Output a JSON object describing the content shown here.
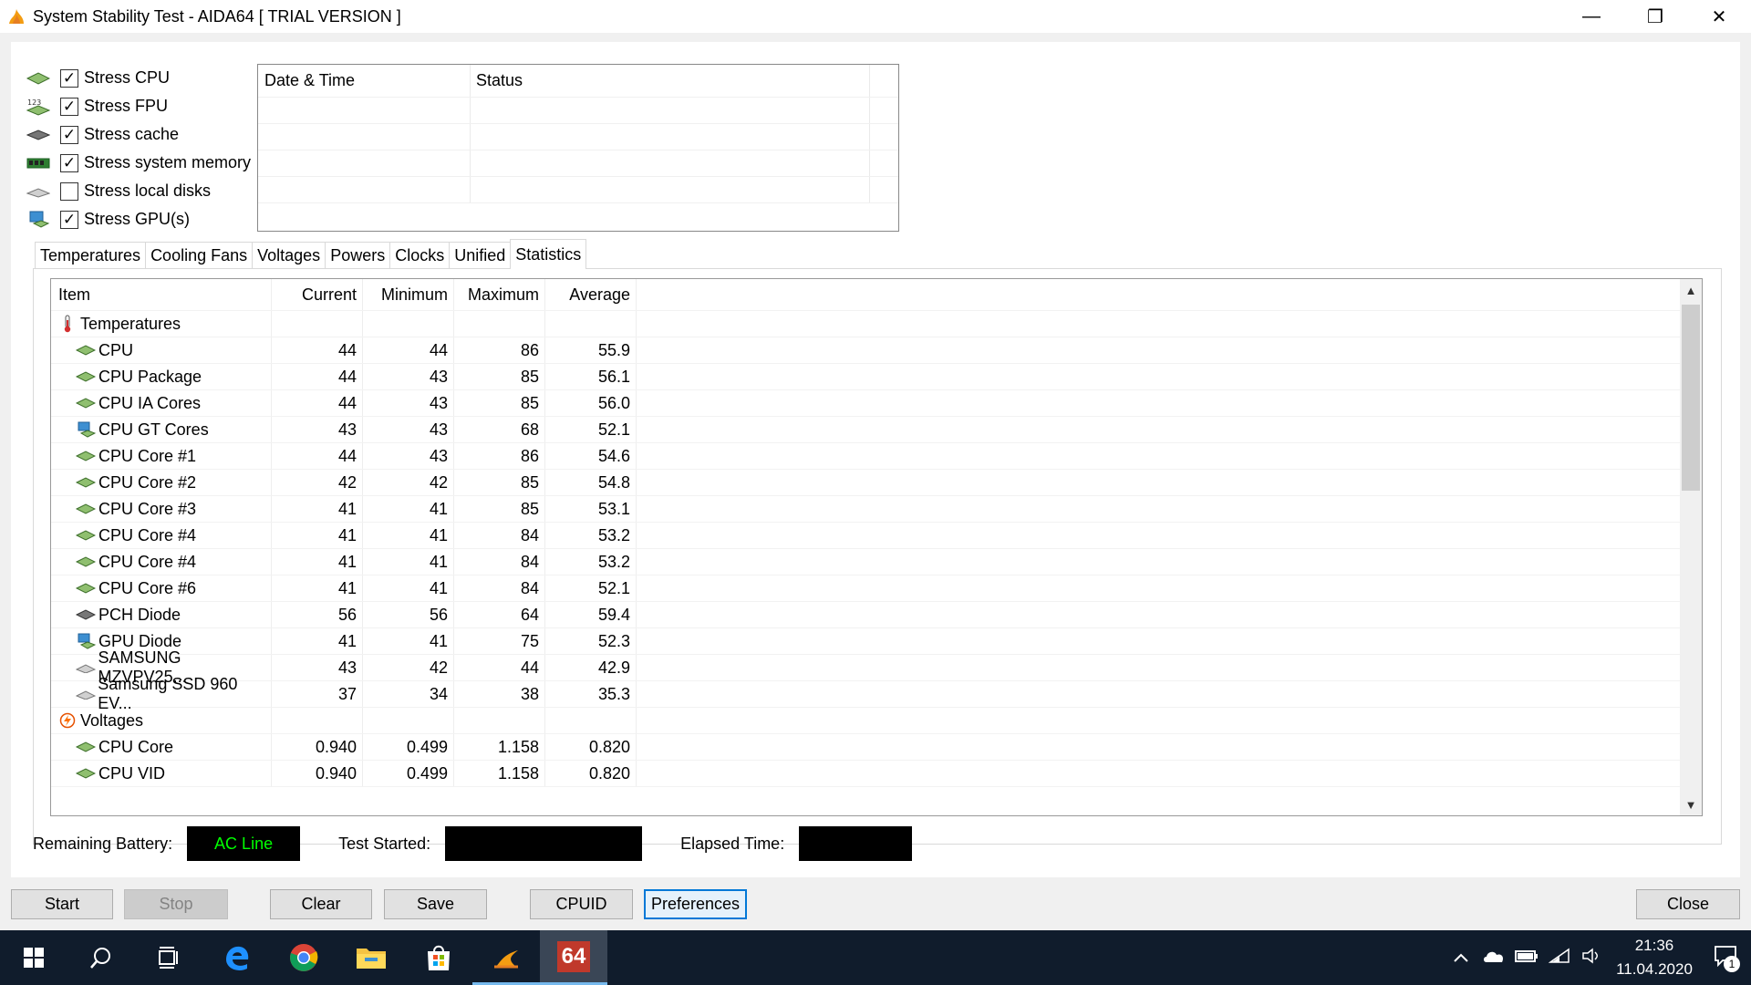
{
  "window": {
    "title": "System Stability Test - AIDA64  [ TRIAL VERSION ]",
    "minimize": "—",
    "maximize": "❐",
    "close": "✕"
  },
  "stress_options": [
    {
      "label": "Stress CPU",
      "checked": true,
      "icon": "cpu-chip-icon",
      "mark": "✓"
    },
    {
      "label": "Stress FPU",
      "checked": true,
      "icon": "fpu-chip-icon",
      "mark": "✓"
    },
    {
      "label": "Stress cache",
      "checked": true,
      "icon": "cache-chip-icon",
      "mark": "✓"
    },
    {
      "label": "Stress system memory",
      "checked": true,
      "icon": "memory-module-icon",
      "mark": "✓"
    },
    {
      "label": "Stress local disks",
      "checked": false,
      "icon": "disk-drive-icon",
      "mark": ""
    },
    {
      "label": "Stress GPU(s)",
      "checked": true,
      "icon": "gpu-monitor-icon",
      "mark": "✓"
    }
  ],
  "log": {
    "headers": {
      "datetime": "Date & Time",
      "status": "Status"
    }
  },
  "tabs": [
    "Temperatures",
    "Cooling Fans",
    "Voltages",
    "Powers",
    "Clocks",
    "Unified",
    "Statistics"
  ],
  "active_tab": "Statistics",
  "stats": {
    "headers": {
      "item": "Item",
      "current": "Current",
      "minimum": "Minimum",
      "maximum": "Maximum",
      "average": "Average"
    },
    "rows": [
      {
        "type": "group",
        "icon": "thermometer-icon",
        "item": "Temperatures"
      },
      {
        "type": "child",
        "icon": "cpu-chip-icon",
        "item": "CPU",
        "current": "44",
        "minimum": "44",
        "maximum": "86",
        "average": "55.9"
      },
      {
        "type": "child",
        "icon": "cpu-chip-icon",
        "item": "CPU Package",
        "current": "44",
        "minimum": "43",
        "maximum": "85",
        "average": "56.1"
      },
      {
        "type": "child",
        "icon": "cpu-chip-icon",
        "item": "CPU IA Cores",
        "current": "44",
        "minimum": "43",
        "maximum": "85",
        "average": "56.0"
      },
      {
        "type": "child",
        "icon": "gpu-monitor-icon",
        "item": "CPU GT Cores",
        "current": "43",
        "minimum": "43",
        "maximum": "68",
        "average": "52.1"
      },
      {
        "type": "child",
        "icon": "cpu-chip-icon",
        "item": "CPU Core #1",
        "current": "44",
        "minimum": "43",
        "maximum": "86",
        "average": "54.6"
      },
      {
        "type": "child",
        "icon": "cpu-chip-icon",
        "item": "CPU Core #2",
        "current": "42",
        "minimum": "42",
        "maximum": "85",
        "average": "54.8"
      },
      {
        "type": "child",
        "icon": "cpu-chip-icon",
        "item": "CPU Core #3",
        "current": "41",
        "minimum": "41",
        "maximum": "85",
        "average": "53.1"
      },
      {
        "type": "child",
        "icon": "cpu-chip-icon",
        "item": "CPU Core #4",
        "current": "41",
        "minimum": "41",
        "maximum": "84",
        "average": "53.2"
      },
      {
        "type": "child",
        "icon": "cpu-chip-icon",
        "item": "CPU Core #4",
        "current": "41",
        "minimum": "41",
        "maximum": "84",
        "average": "53.2"
      },
      {
        "type": "child",
        "icon": "cpu-chip-icon",
        "item": "CPU Core #6",
        "current": "41",
        "minimum": "41",
        "maximum": "84",
        "average": "52.1"
      },
      {
        "type": "child",
        "icon": "pch-chip-icon",
        "item": "PCH Diode",
        "current": "56",
        "minimum": "56",
        "maximum": "64",
        "average": "59.4"
      },
      {
        "type": "child",
        "icon": "gpu-monitor-icon",
        "item": "GPU Diode",
        "current": "41",
        "minimum": "41",
        "maximum": "75",
        "average": "52.3"
      },
      {
        "type": "child",
        "icon": "disk-drive-icon",
        "item": "SAMSUNG MZVPV25...",
        "current": "43",
        "minimum": "42",
        "maximum": "44",
        "average": "42.9"
      },
      {
        "type": "child",
        "icon": "disk-drive-icon",
        "item": "Samsung SSD 960 EV...",
        "current": "37",
        "minimum": "34",
        "maximum": "38",
        "average": "35.3"
      },
      {
        "type": "group",
        "icon": "voltage-icon",
        "item": "Voltages"
      },
      {
        "type": "child",
        "icon": "cpu-chip-icon",
        "item": "CPU Core",
        "current": "0.940",
        "minimum": "0.499",
        "maximum": "1.158",
        "average": "0.820"
      },
      {
        "type": "child",
        "icon": "cpu-chip-icon",
        "item": "CPU VID",
        "current": "0.940",
        "minimum": "0.499",
        "maximum": "1.158",
        "average": "0.820"
      }
    ]
  },
  "status": {
    "battery_label": "Remaining Battery:",
    "battery_value": "AC Line",
    "test_started_label": "Test Started:",
    "test_started_value": "",
    "elapsed_label": "Elapsed Time:",
    "elapsed_value": ""
  },
  "buttons": {
    "start": "Start",
    "stop": "Stop",
    "clear": "Clear",
    "save": "Save",
    "cpuid": "CPUID",
    "preferences": "Preferences",
    "close": "Close"
  },
  "taskbar": {
    "apps": [
      "start-windows-icon",
      "search-icon",
      "task-view-icon",
      "edge-browser-icon",
      "chrome-browser-icon",
      "file-explorer-icon",
      "store-icon",
      "app-flame-icon",
      "aida64-icon"
    ],
    "aida64_label": "64",
    "time": "21:36",
    "date": "11.04.2020",
    "notification_count": "1"
  },
  "colors": {
    "battery_text": "#00ff00",
    "focus_border": "#0078d7",
    "taskbar_bg": "#101c2c"
  }
}
